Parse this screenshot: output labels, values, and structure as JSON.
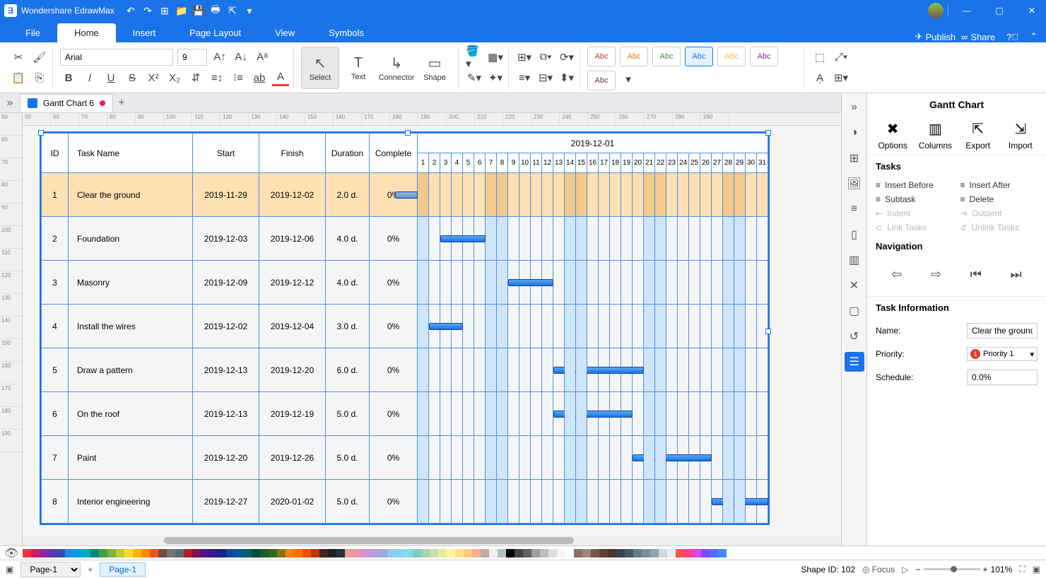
{
  "app_title": "Wondershare EdrawMax",
  "menubar": {
    "tabs": [
      "File",
      "Home",
      "Insert",
      "Page Layout",
      "View",
      "Symbols"
    ],
    "active": 1,
    "publish": "Publish",
    "share": "Share"
  },
  "font": {
    "name": "Arial",
    "size": "9"
  },
  "ribbon": {
    "select": "Select",
    "text": "Text",
    "connector": "Connector",
    "shape": "Shape",
    "swatch": "Abc"
  },
  "doctab": "Gantt Chart 6",
  "ruler_h": [
    "50",
    "60",
    "70",
    "80",
    "90",
    "100",
    "110",
    "120",
    "130",
    "140",
    "150",
    "160",
    "170",
    "180",
    "190",
    "200",
    "210",
    "220",
    "230",
    "240",
    "250",
    "260",
    "270",
    "280",
    "290"
  ],
  "ruler_v": [
    "50",
    "60",
    "70",
    "80",
    "90",
    "100",
    "110",
    "120",
    "130",
    "140",
    "150",
    "160",
    "170",
    "180",
    "190"
  ],
  "chart_data": {
    "type": "table",
    "title": "2019-12-01",
    "headers": [
      "ID",
      "Task Name",
      "Start",
      "Finish",
      "Duration",
      "Complete"
    ],
    "days": [
      "1",
      "2",
      "3",
      "4",
      "5",
      "6",
      "7",
      "8",
      "9",
      "10",
      "11",
      "12",
      "13",
      "14",
      "15",
      "16",
      "17",
      "18",
      "19",
      "20",
      "21",
      "22",
      "23",
      "24",
      "25",
      "26",
      "27",
      "28",
      "29",
      "30",
      "31"
    ],
    "weekends": [
      1,
      7,
      8,
      14,
      15,
      21,
      22,
      28,
      29
    ],
    "rows": [
      {
        "id": "1",
        "name": "Clear the ground",
        "start": "2019-11-29",
        "finish": "2019-12-02",
        "dur": "2.0 d.",
        "comp": "0%",
        "bar_start": -2,
        "bar_len": 2,
        "sel": true
      },
      {
        "id": "2",
        "name": "Foundation",
        "start": "2019-12-03",
        "finish": "2019-12-06",
        "dur": "4.0 d.",
        "comp": "0%",
        "bar_start": 2,
        "bar_len": 4
      },
      {
        "id": "3",
        "name": "Masonry",
        "start": "2019-12-09",
        "finish": "2019-12-12",
        "dur": "4.0 d.",
        "comp": "0%",
        "bar_start": 8,
        "bar_len": 4
      },
      {
        "id": "4",
        "name": "Install the wires",
        "start": "2019-12-02",
        "finish": "2019-12-04",
        "dur": "3.0 d.",
        "comp": "0%",
        "bar_start": 1,
        "bar_len": 3
      },
      {
        "id": "5",
        "name": "Draw a pattern",
        "start": "2019-12-13",
        "finish": "2019-12-20",
        "dur": "6.0 d.",
        "comp": "0%",
        "bar_start": 12,
        "bar_len": 8
      },
      {
        "id": "6",
        "name": "On the roof",
        "start": "2019-12-13",
        "finish": "2019-12-19",
        "dur": "5.0 d.",
        "comp": "0%",
        "bar_start": 12,
        "bar_len": 7
      },
      {
        "id": "7",
        "name": "Paint",
        "start": "2019-12-20",
        "finish": "2019-12-26",
        "dur": "5.0 d.",
        "comp": "0%",
        "bar_start": 19,
        "bar_len": 7
      },
      {
        "id": "8",
        "name": "Interior engineering",
        "start": "2019-12-27",
        "finish": "2020-01-02",
        "dur": "5.0 d.",
        "comp": "0%",
        "bar_start": 26,
        "bar_len": 5
      }
    ]
  },
  "rpanel": {
    "title": "Gantt Chart",
    "top": [
      "Options",
      "Columns",
      "Export",
      "Import"
    ],
    "sec1": "Tasks",
    "tasks": [
      "Insert Before",
      "Insert After",
      "Subtask",
      "Delete",
      "Indent",
      "Outdent",
      "Link Tasks",
      "Unlink Tasks"
    ],
    "disabled": [
      4,
      5,
      6,
      7
    ],
    "sec2": "Navigation",
    "sec3": "Task Information",
    "fields": {
      "name_l": "Name:",
      "name_v": "Clear the ground",
      "prio_l": "Priority:",
      "prio_v": "Priority 1",
      "sched_l": "Schedule:",
      "sched_v": "0.0%"
    }
  },
  "status": {
    "page_sel": "Page-1",
    "page_tab": "Page-1",
    "shape_id": "Shape ID: 102",
    "focus": "Focus",
    "zoom": "101%"
  },
  "colors": [
    "#e53935",
    "#d81b60",
    "#8e24aa",
    "#5e35b1",
    "#3949ab",
    "#1e88e5",
    "#039be5",
    "#00acc1",
    "#00897b",
    "#43a047",
    "#7cb342",
    "#c0ca33",
    "#fdd835",
    "#ffb300",
    "#fb8c00",
    "#f4511e",
    "#6d4c41",
    "#757575",
    "#546e7a",
    "#b71c1c",
    "#880e4f",
    "#4a148c",
    "#311b92",
    "#1a237e",
    "#0d47a1",
    "#01579b",
    "#006064",
    "#004d40",
    "#1b5e20",
    "#33691e",
    "#827717",
    "#f57f17",
    "#ff6f00",
    "#e65100",
    "#bf360c",
    "#3e2723",
    "#212121",
    "#263238",
    "#ef9a9a",
    "#f48fb1",
    "#ce93d8",
    "#b39ddb",
    "#9fa8da",
    "#90caf9",
    "#81d4fa",
    "#80deea",
    "#80cbc4",
    "#a5d6a7",
    "#c5e1a5",
    "#e6ee9c",
    "#fff59d",
    "#ffe082",
    "#ffcc80",
    "#ffab91",
    "#bcaaa4",
    "#eeeeee",
    "#b0bec5",
    "#000000",
    "#424242",
    "#616161",
    "#9e9e9e",
    "#bdbdbd",
    "#e0e0e0",
    "#f5f5f5",
    "#ffffff",
    "#8d6e63",
    "#a1887f",
    "#795548",
    "#5d4037",
    "#4e342e",
    "#37474f",
    "#455a64",
    "#607d8b",
    "#78909c",
    "#90a4ae",
    "#cfd8dc",
    "#eceff1",
    "#ff5252",
    "#ff4081",
    "#e040fb",
    "#7c4dff",
    "#536dfe",
    "#448aff"
  ]
}
